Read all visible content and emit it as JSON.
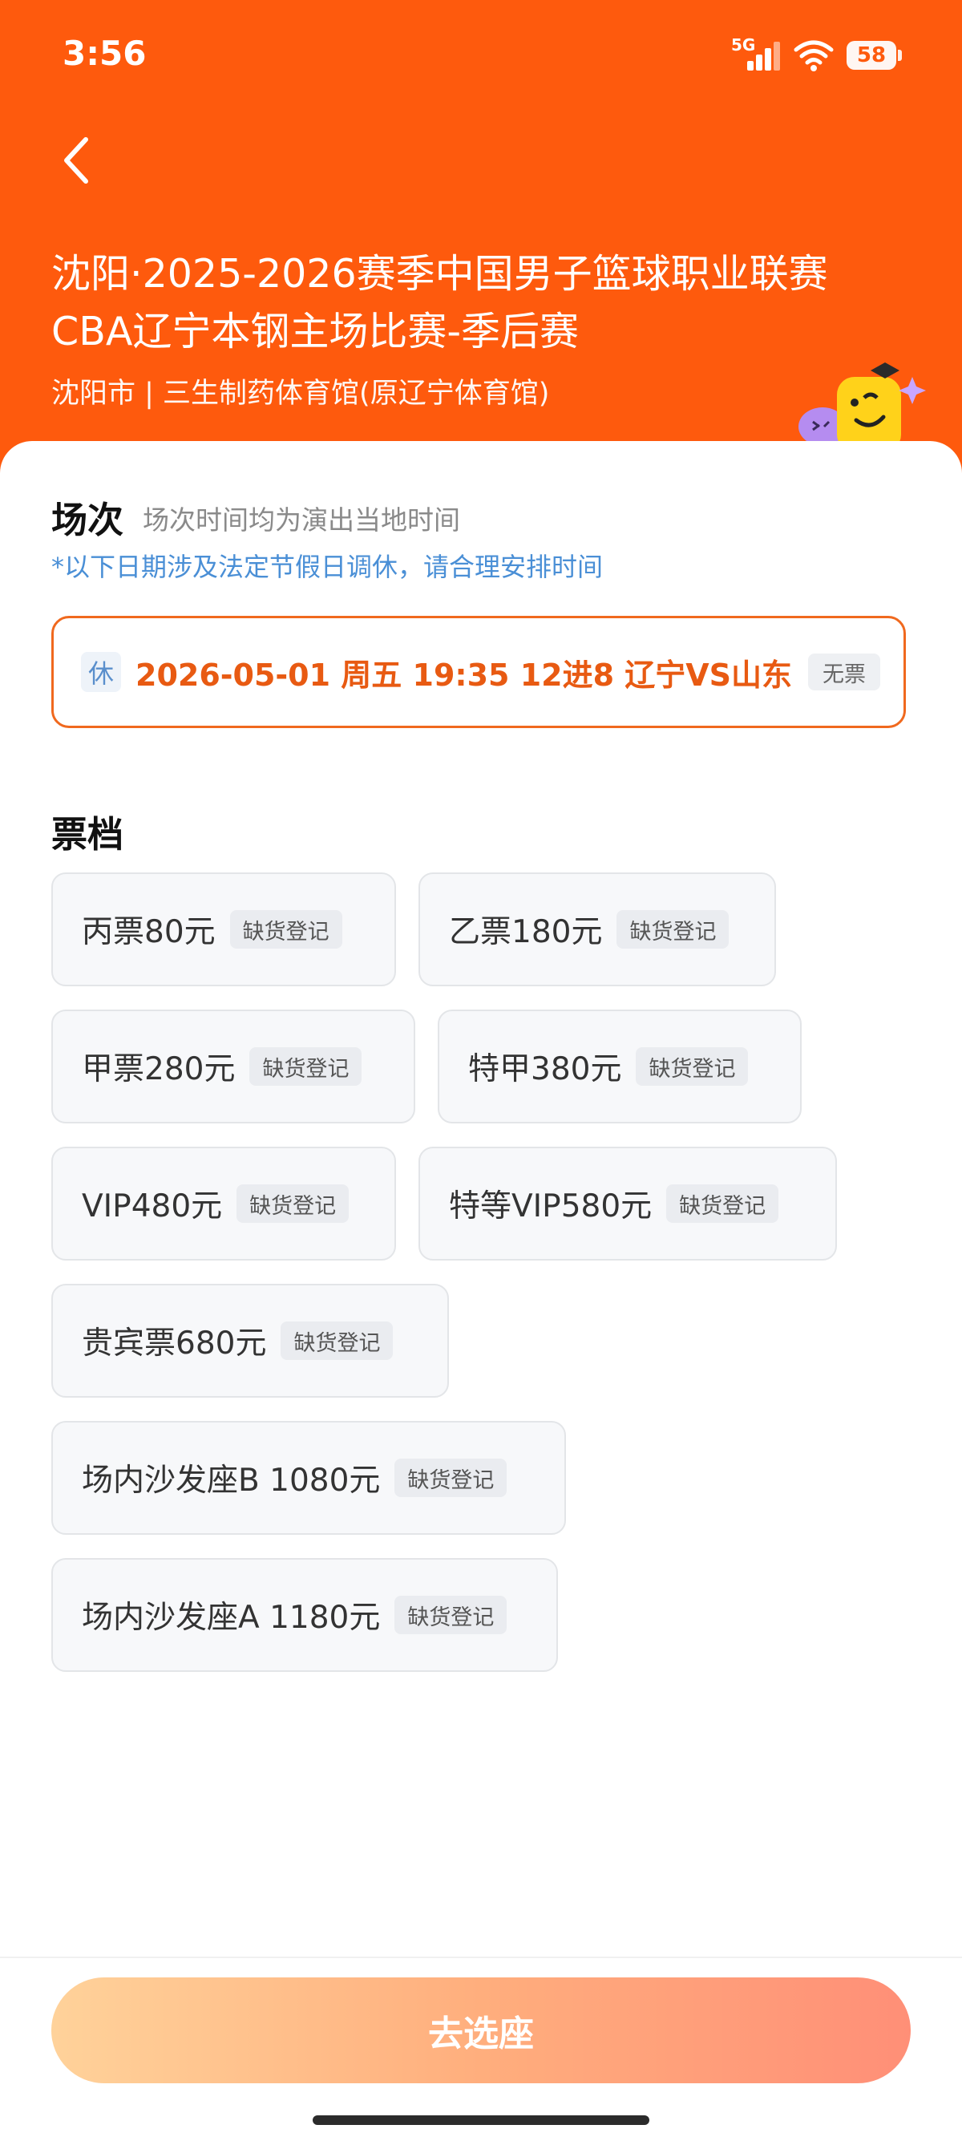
{
  "status_bar": {
    "time": "3:56",
    "network": "5G",
    "battery": "58"
  },
  "header": {
    "title_line1": "沈阳·2025-2026赛季中国男子篮球职业联赛",
    "title_line2": "CBA辽宁本钢主场比赛-季后赛",
    "venue": "沈阳市 | 三生制药体育馆(原辽宁体育馆)",
    "background_color": "#fe5a0d"
  },
  "session": {
    "heading": "场次",
    "note": "场次时间均为演出当地时间",
    "holiday_note": "*以下日期涉及法定节假日调休，请合理安排时间",
    "selected": {
      "rest_badge": "休",
      "text": "2026-05-01 周五 19:35 12进8 辽宁VS山东",
      "status": "无票"
    }
  },
  "tiers": {
    "heading": "票档",
    "items": [
      {
        "label": "丙票80元",
        "status": "缺货登记"
      },
      {
        "label": "乙票180元",
        "status": "缺货登记"
      },
      {
        "label": "甲票280元",
        "status": "缺货登记"
      },
      {
        "label": "特甲380元",
        "status": "缺货登记"
      },
      {
        "label": "VIP480元",
        "status": "缺货登记"
      },
      {
        "label": "特等VIP580元",
        "status": "缺货登记"
      },
      {
        "label": "贵宾票680元",
        "status": "缺货登记"
      },
      {
        "label": "场内沙发座B 1080元",
        "status": "缺货登记"
      },
      {
        "label": "场内沙发座A 1180元",
        "status": "缺货登记"
      }
    ]
  },
  "footer": {
    "button_label": "去选座"
  }
}
